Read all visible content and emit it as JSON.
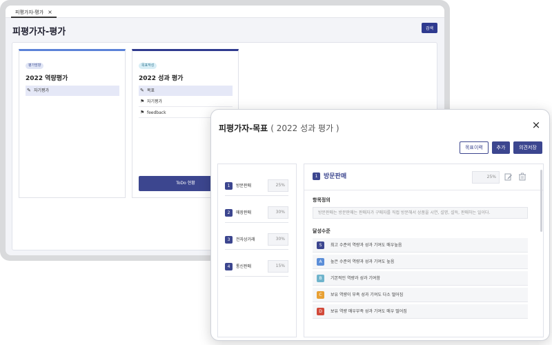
{
  "bg": {
    "tab_label": "피평가자-평가",
    "tab_close": "×",
    "page_title": "피평가자-평가",
    "search_label": "검색",
    "cards": [
      {
        "badge": "평가방향",
        "title": "2022 역량평가",
        "items": [
          "자기평가"
        ]
      },
      {
        "badge": "목표작성",
        "title": "2022 성과 평가",
        "items": [
          "목표",
          "자기평가",
          "feedback"
        ],
        "todo_label": "ToDo 현황"
      }
    ]
  },
  "modal": {
    "title": "피평가자-목표",
    "subtitle": "( 2022 성과 평가 )",
    "close": "×",
    "buttons": {
      "history": "목표이력",
      "add": "추가",
      "save": "의견저장"
    },
    "goals": [
      {
        "num": "1",
        "label": "방문판매",
        "pct": "25%"
      },
      {
        "num": "2",
        "label": "매장판매",
        "pct": "30%"
      },
      {
        "num": "3",
        "label": "전자상거래",
        "pct": "30%"
      },
      {
        "num": "4",
        "label": "통신판매",
        "pct": "15%"
      }
    ],
    "detail": {
      "num": "1",
      "title": "방문판매",
      "pct": "25%",
      "definition_label": "항목정의",
      "definition_text": "방문판매는 방문판매는 판매자가 구매자를 직접 방문해서 상품을 시연, 설명, 설득, 판매하는 일이다.",
      "levels_label": "달성수준",
      "levels": [
        {
          "grade": "S",
          "text": "최고 수준의 역량과 성과 기여도 매우높음",
          "color": "#3c468f"
        },
        {
          "grade": "A",
          "text": "높은 수준의 역량과 성과 기여도 높음",
          "color": "#5b8ed8"
        },
        {
          "grade": "B",
          "text": "기본적인 역량과 성과 기여함",
          "color": "#6fb4cc"
        },
        {
          "grade": "C",
          "text": "보유 역량이 부족 성과 기여도 다소 떨어짐",
          "color": "#e8a033"
        },
        {
          "grade": "D",
          "text": "보유 역량 매우부족 성과 기여도 매우 떨어짐",
          "color": "#d24a3a"
        }
      ]
    }
  }
}
